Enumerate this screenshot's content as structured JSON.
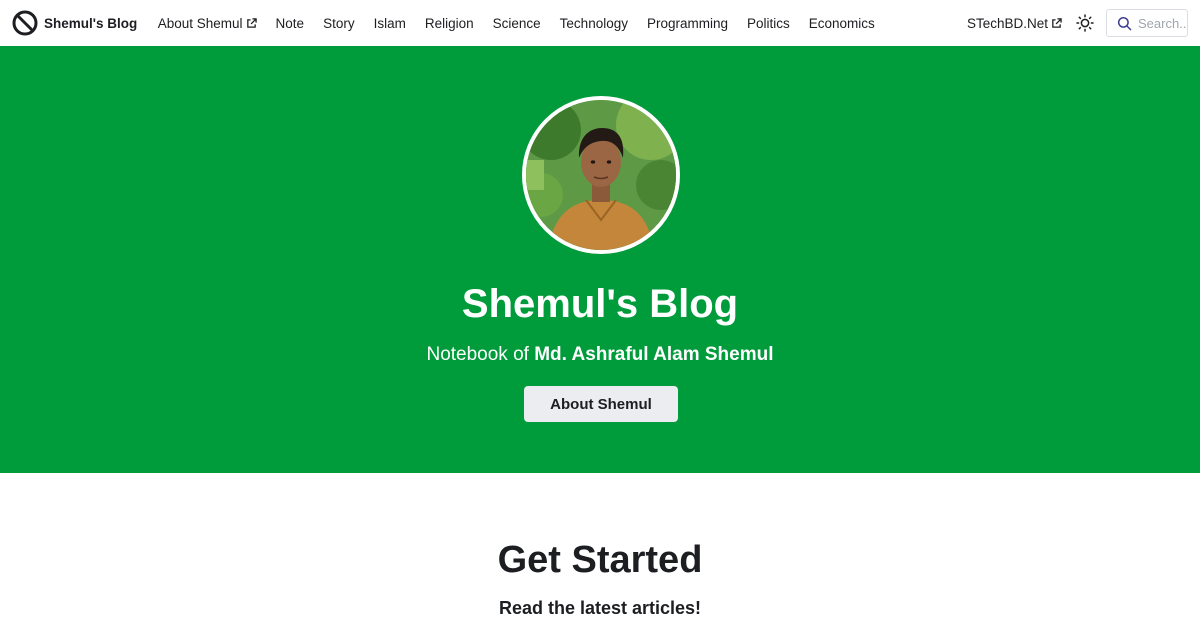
{
  "navbar": {
    "brand_title": "Shemul's Blog",
    "items": [
      {
        "label": "About Shemul",
        "external": true
      },
      {
        "label": "Note"
      },
      {
        "label": "Story"
      },
      {
        "label": "Islam"
      },
      {
        "label": "Religion"
      },
      {
        "label": "Science"
      },
      {
        "label": "Technology"
      },
      {
        "label": "Programming"
      },
      {
        "label": "Politics"
      },
      {
        "label": "Economics"
      }
    ],
    "right_link": "STechBD.Net",
    "theme_icon": "sun-icon",
    "search_placeholder": "Search..."
  },
  "hero": {
    "title": "Shemul's Blog",
    "subtitle_prefix": "Notebook of ",
    "subtitle_name": "Md. Ashraful Alam Shemul",
    "button_label": "About Shemul",
    "background": "#009b3a"
  },
  "section": {
    "heading": "Get Started",
    "subheading": "Read the latest articles!"
  },
  "colors": {
    "hero_green": "#009b3a",
    "button_bg": "#ebedf0",
    "text": "#1c1e21"
  }
}
